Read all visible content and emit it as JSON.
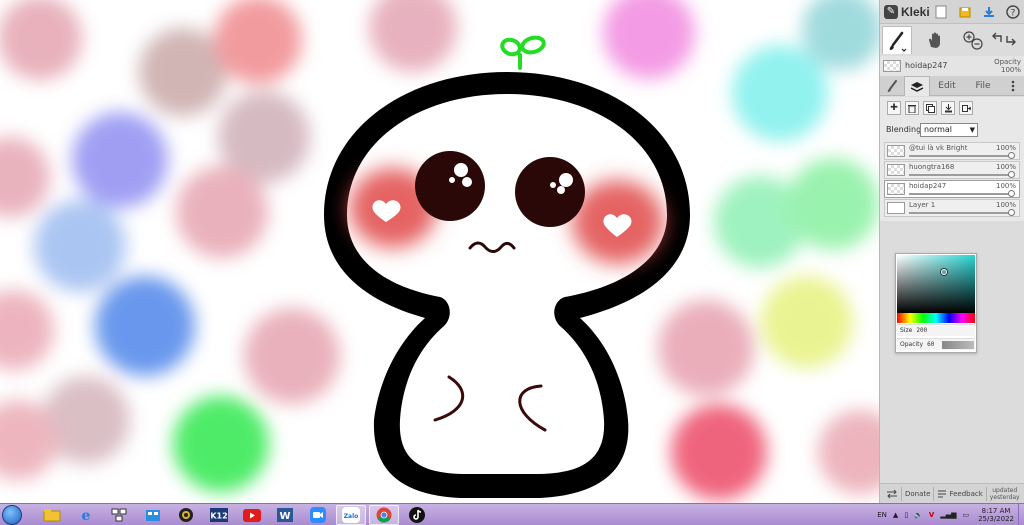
{
  "app": {
    "name": "Kleki"
  },
  "current_layer": {
    "name": "hoidap247",
    "opacity_label": "Opacity",
    "opacity_value": "100%"
  },
  "tabs": [
    {
      "label": ""
    },
    {
      "label": ""
    },
    {
      "label": "Edit"
    },
    {
      "label": "File"
    }
  ],
  "blending": {
    "label": "Blending",
    "value": "normal"
  },
  "layers": [
    {
      "name": "@tui là vk Bright",
      "opacity": "100%"
    },
    {
      "name": "huongtra168",
      "opacity": "100%"
    },
    {
      "name": "hoidap247",
      "opacity": "100%"
    },
    {
      "name": "Layer 1",
      "opacity": "100%"
    }
  ],
  "brush": {
    "size_label": "Size",
    "size_value": "200",
    "opacity_label": "Opacity",
    "opacity_value": "60"
  },
  "bottom": {
    "donate": "Donate",
    "feedback": "Feedback",
    "updated_line1": "updated",
    "updated_line2": "yesterday"
  },
  "taskbar": {
    "apps": [
      "file-explorer",
      "internet-explorer",
      "network-app",
      "windows-store",
      "camera-app",
      "k12",
      "youtube",
      "word",
      "zoom",
      "zalo",
      "chrome",
      "tiktok"
    ],
    "zalo_label": "Zalo",
    "k12_label": "K12",
    "language": "EN",
    "time": "8:17 AM",
    "date": "25/3/2022"
  },
  "colors": {
    "panel_bg": "#dcdcdc",
    "taskbar": "#b49ad8",
    "cheek": "#e05a5a",
    "sprout": "#22dd22",
    "outline": "#000000"
  }
}
